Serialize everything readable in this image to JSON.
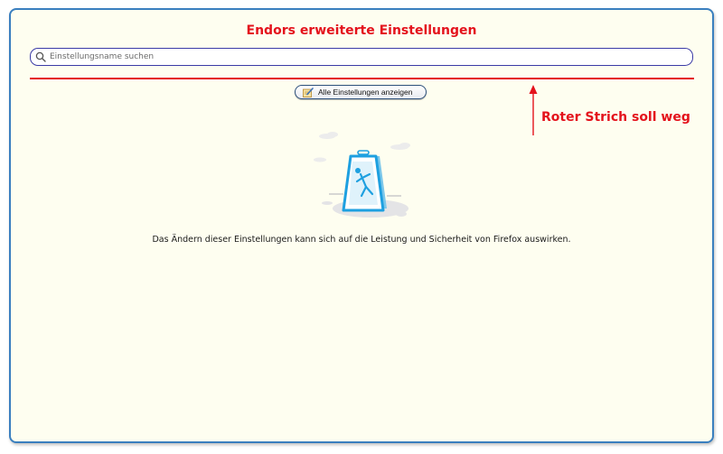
{
  "title": "Endors erweiterte Einstellungen",
  "search": {
    "placeholder": "Einstellungsname suchen",
    "value": ""
  },
  "show_all_button": {
    "label": "Alle Einstellungen anzeigen"
  },
  "annotation": {
    "text": "Roter Strich soll weg"
  },
  "warning_text": "Das Ändern dieser Einstellungen kann sich auf die Leistung und Sicherheit von Firefox auswirken.",
  "colors": {
    "accent_red": "#e4121c",
    "background": "#fefef0",
    "frame_border": "#3a7fbf",
    "illustration_blue": "#1ea0e0"
  }
}
